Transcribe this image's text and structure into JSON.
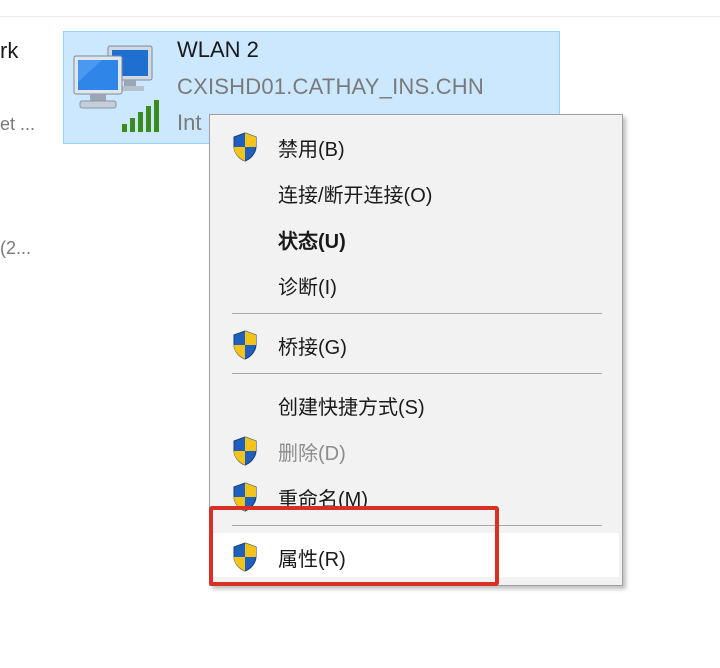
{
  "left_fragments": {
    "top_label": "rk",
    "mid_label": "et ...",
    "lower_label": "(2..."
  },
  "adapter": {
    "name": "WLAN 2",
    "network": "CXISHD01.CATHAY_INS.CHN",
    "device": "Int"
  },
  "menu": {
    "items": [
      {
        "label": "禁用(B)",
        "icon": "uac-shield-icon"
      },
      {
        "label": "连接/断开连接(O)"
      },
      {
        "label": "状态(U)",
        "bold": true
      },
      {
        "label": "诊断(I)"
      },
      {
        "label": "桥接(G)",
        "icon": "uac-shield-icon"
      },
      {
        "label": "创建快捷方式(S)"
      },
      {
        "label": "删除(D)",
        "icon": "uac-shield-icon",
        "disabled": true
      },
      {
        "label": "重命名(M)",
        "icon": "uac-shield-icon"
      },
      {
        "label": "属性(R)",
        "icon": "uac-shield-icon",
        "hover": true
      }
    ]
  },
  "colors": {
    "selection": "#cce8ff",
    "highlight_box": "#d93025",
    "menu_bg": "#f2f2f2"
  }
}
